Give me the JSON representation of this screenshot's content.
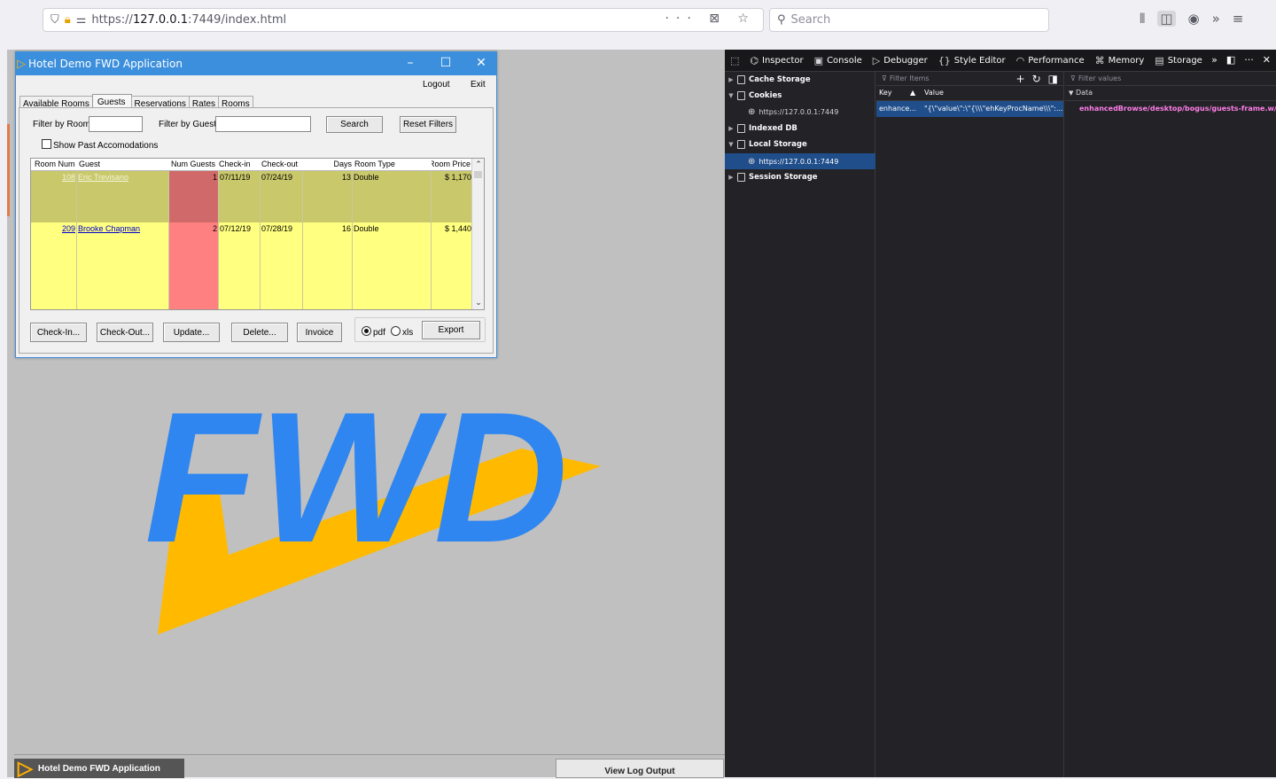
{
  "browser": {
    "url_prefix": "https://",
    "url_host": "127.0.0.1",
    "url_rest": ":7449/index.html",
    "url_icons": "··· ⊠ ☆",
    "search_placeholder": "Search"
  },
  "app": {
    "title": "Hotel Demo FWD Application",
    "logout": "Logout",
    "exit": "Exit",
    "tabs": [
      {
        "label": "Available Rooms"
      },
      {
        "label": "Guests"
      },
      {
        "label": "Reservations"
      },
      {
        "label": "Rates"
      },
      {
        "label": "Rooms"
      }
    ],
    "filters": {
      "room_label": "Filter by Room:",
      "guest_label": "Filter by Guest:",
      "search": "Search",
      "reset": "Reset Filters",
      "show_past": "Show Past Accomodations"
    },
    "columns": [
      "Room Num",
      "Guest",
      "Num Guests",
      "Check-in",
      "Check-out",
      "Days",
      "Room Type",
      "Room Price"
    ],
    "rows": [
      {
        "room": "108",
        "guest": "Eric Trevisano",
        "num": "1",
        "checkin": "07/11/19",
        "checkout": "07/24/19",
        "days": "13",
        "type": "Double",
        "price": "$ 1,170"
      },
      {
        "room": "209",
        "guest": "Brooke Chapman",
        "num": "2",
        "checkin": "07/12/19",
        "checkout": "07/28/19",
        "days": "16",
        "type": "Double",
        "price": "$ 1,440"
      }
    ],
    "buttons": {
      "checkin": "Check-In...",
      "checkout": "Check-Out...",
      "update": "Update...",
      "delete": "Delete...",
      "invoice": "Invoice",
      "pdf": "pdf",
      "xls": "xls",
      "export": "Export"
    },
    "colors": {
      "selected_row": "#c9c86a",
      "row": "#ffff80",
      "num_selected": "#d06a6a",
      "num": "#ff8080"
    }
  },
  "logo": {
    "text": "FWD",
    "blue": "#2f86f0",
    "orange": "#ffba00"
  },
  "taskbar": {
    "app": "Hotel Demo FWD Application",
    "view_log": "View Log Output"
  },
  "devtools": {
    "tabs": [
      "Inspector",
      "Console",
      "Debugger",
      "Style Editor",
      "Performance",
      "Memory",
      "Storage"
    ],
    "tree": [
      {
        "label": "Cache Storage"
      },
      {
        "label": "Cookies"
      },
      {
        "label": "https://127.0.0.1:7449"
      },
      {
        "label": "Indexed DB"
      },
      {
        "label": "Local Storage"
      },
      {
        "label": "https://127.0.0.1:7449"
      },
      {
        "label": "Session Storage"
      }
    ],
    "filter_items": "Filter Items",
    "filter_values": "Filter values",
    "col_key": "Key",
    "col_value": "Value",
    "row_key": "enhance...",
    "row_value": "\"{\\\"value\\\":\\\"{\\\\\\\"ehKeyProcName\\\\\\\":...",
    "data_label": "Data",
    "data_value": "enhancedBrowse/desktop/bogus/guests-frame.w/st"
  }
}
